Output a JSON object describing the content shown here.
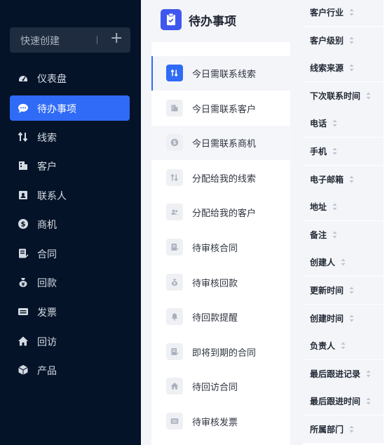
{
  "sidebar": {
    "quick_create": {
      "label": "快速创建",
      "plus": "+"
    },
    "items": [
      {
        "label": "仪表盘",
        "icon": "dashboard-icon",
        "active": false
      },
      {
        "label": "待办事项",
        "icon": "chat-bubble-icon",
        "active": true
      },
      {
        "label": "线索",
        "icon": "leads-icon",
        "active": false
      },
      {
        "label": "客户",
        "icon": "building-icon",
        "active": false
      },
      {
        "label": "联系人",
        "icon": "contact-card-icon",
        "active": false
      },
      {
        "label": "商机",
        "icon": "dollar-coin-icon",
        "active": false
      },
      {
        "label": "合同",
        "icon": "contract-doc-icon",
        "active": false
      },
      {
        "label": "回款",
        "icon": "money-bag-icon",
        "active": false
      },
      {
        "label": "发票",
        "icon": "invoice-icon",
        "active": false
      },
      {
        "label": "回访",
        "icon": "house-icon",
        "active": false
      },
      {
        "label": "产品",
        "icon": "cube-icon",
        "active": false
      }
    ]
  },
  "todo_panel": {
    "title": "待办事项",
    "title_icon": "clipboard-icon",
    "items": [
      {
        "label": "今日需联系线索",
        "icon": "leads-icon",
        "active": true
      },
      {
        "label": "今日需联系客户",
        "icon": "building-icon",
        "active": false
      },
      {
        "label": "今日需联系商机",
        "icon": "dollar-coin-icon",
        "active": false
      },
      {
        "label": "分配给我的线索",
        "icon": "leads-icon",
        "active": false
      },
      {
        "label": "分配给我的客户",
        "icon": "people-icon",
        "active": false
      },
      {
        "label": "待审核合同",
        "icon": "contract-doc-icon",
        "active": false
      },
      {
        "label": "待审核回款",
        "icon": "money-bag-icon",
        "active": false
      },
      {
        "label": "待回款提醒",
        "icon": "bell-icon",
        "active": false
      },
      {
        "label": "即将到期的合同",
        "icon": "contract-doc-icon",
        "active": false
      },
      {
        "label": "待回访合同",
        "icon": "house-icon",
        "active": false
      },
      {
        "label": "待审核发票",
        "icon": "invoice-icon",
        "active": false
      }
    ]
  },
  "table": {
    "columns": [
      "客户行业",
      "客户级别",
      "线索来源",
      "下次联系时间",
      "电话",
      "手机",
      "电子邮箱",
      "地址",
      "备注",
      "创建人",
      "更新时间",
      "创建时间",
      "负责人",
      "最后跟进记录",
      "最后跟进时间",
      "所属部门"
    ]
  },
  "colors": {
    "sidebar_bg": "#041328",
    "accent": "#2f6bf6",
    "panel_bg": "#f4f5f8"
  }
}
